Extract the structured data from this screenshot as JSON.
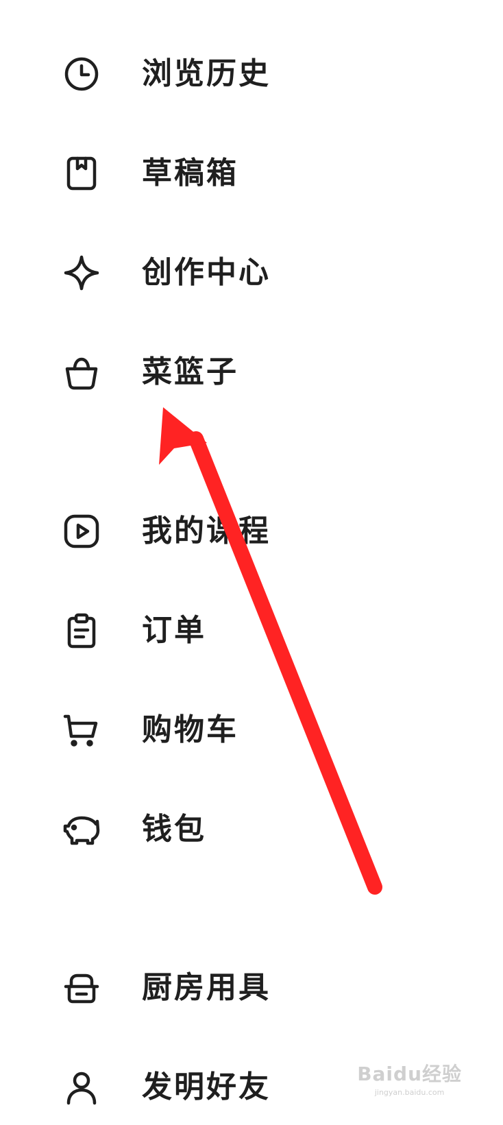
{
  "menu": {
    "items": [
      {
        "label": "浏览历史",
        "icon": "clock-icon"
      },
      {
        "label": "草稿箱",
        "icon": "draft-bookmark-icon"
      },
      {
        "label": "创作中心",
        "icon": "sparkle-icon"
      },
      {
        "label": "菜篮子",
        "icon": "basket-icon"
      },
      {
        "label": "我的课程",
        "icon": "play-icon"
      },
      {
        "label": "订单",
        "icon": "clipboard-icon"
      },
      {
        "label": "购物车",
        "icon": "cart-icon"
      },
      {
        "label": "钱包",
        "icon": "piggy-bank-icon"
      },
      {
        "label": "厨房用具",
        "icon": "cookware-icon"
      },
      {
        "label": "发明好友",
        "icon": "user-icon"
      }
    ]
  },
  "annotation": {
    "arrow_color": "#ff2323"
  },
  "watermark": {
    "main": "Baidu经验",
    "sub": "jingyan.baidu.com"
  },
  "colors": {
    "text": "#1f1f1f",
    "icon": "#1f1f1f",
    "background": "#ffffff"
  }
}
